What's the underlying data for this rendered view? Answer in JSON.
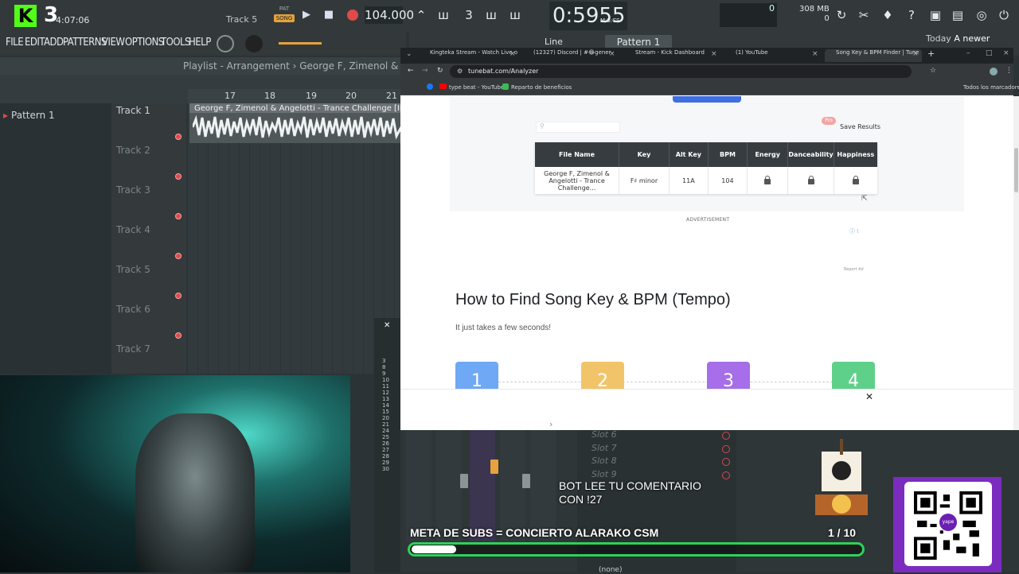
{
  "fl": {
    "kick_logo": "K",
    "kick_number": "3",
    "clock": "4:07:06",
    "track_label": "Track 5",
    "pat_label": "PAT",
    "song_label": "SONG",
    "tempo": "104.000",
    "time": "0:59",
    "time_sub": "55",
    "time_units": "M:S:CS",
    "cpu_value": "0",
    "memory": "308 MB",
    "memory_sub": "0",
    "menu": [
      "FILE",
      "EDIT",
      "ADD",
      "PATTERNS",
      "VIEW",
      "OPTIONS",
      "TOOLS",
      "HELP"
    ],
    "pattern_button": "Pattern 1",
    "line_label": "Line",
    "newer_label": "Today",
    "newer_text": "A newer",
    "playlist_path": "Playlist - Arrangement › George F, Zimenol & A",
    "pattern_item": "Pattern 1",
    "ruler": [
      "17",
      "18",
      "19",
      "20",
      "21"
    ],
    "tracks": [
      "Track 1",
      "Track 2",
      "Track 3",
      "Track 4",
      "Track 5",
      "Track 6",
      "Track 7"
    ],
    "clip_label": "George F, Zimenol & Angelotti - Trance Challenge [Instr",
    "mixer_numbers": [
      "3",
      "8",
      "9",
      "10",
      "11",
      "12",
      "13",
      "14",
      "15",
      "20",
      "21",
      "24",
      "25",
      "26",
      "27",
      "28",
      "29",
      "30"
    ],
    "slots": [
      "Slot 6",
      "Slot 7",
      "Slot 8",
      "Slot 9"
    ],
    "slot_none": "(none)"
  },
  "browser": {
    "tabs": [
      {
        "label": "Kingteka Stream - Watch Live o",
        "active": false
      },
      {
        "label": "(12327) Discord | #😂general 🔥",
        "active": false
      },
      {
        "label": "Stream - Kick Dashboard",
        "active": false
      },
      {
        "label": "(1) YouTube",
        "active": false
      },
      {
        "label": "Song Key & BPM Finder | Tune",
        "active": true
      }
    ],
    "new_tab": "+",
    "url": "tunebat.com/Analyzer",
    "bookmarks": [
      "type beat - YouTube",
      "Reparto de beneficios"
    ],
    "all_bookmarks": "Todos los marcadores"
  },
  "page": {
    "search_placeholder": "",
    "pro_badge": "Pro",
    "save_results": "Save Results",
    "table_headers": [
      "File Name",
      "Key",
      "Alt Key",
      "BPM",
      "Energy",
      "Danceability",
      "Happiness"
    ],
    "row": {
      "file": "George F, Zimenol & Angelotti - Trance Challenge...",
      "key": "F♯ minor",
      "alt_key": "11A",
      "bpm": "104"
    },
    "advertisement": "ADVERTISEMENT",
    "report_ad": "Report Ad",
    "heading": "How to Find Song Key & BPM (Tempo)",
    "subheading": "It just takes a few seconds!",
    "steps": [
      {
        "n": "1",
        "color": "#6fa8f5"
      },
      {
        "n": "2",
        "color": "#f2c46a"
      },
      {
        "n": "3",
        "color": "#a66ee8"
      },
      {
        "n": "4",
        "color": "#5fd08a"
      }
    ],
    "ad_close": "✕",
    "ad_arrow": "›"
  },
  "overlay": {
    "bot_line1": "BOT LEE TU COMENTARIO",
    "bot_line2": "CON !27",
    "meta_text": "META DE SUBS = CONCIERTO ALARAKO CSM",
    "meta_count": "1 / 10",
    "meta_progress": 0.1,
    "qr_brand": "yape"
  },
  "colors": {
    "kick_green": "#53fc18",
    "progress_green": "#2ed158",
    "qr_purple": "#7b2cbf",
    "fl_accent": "#e6a23c"
  }
}
